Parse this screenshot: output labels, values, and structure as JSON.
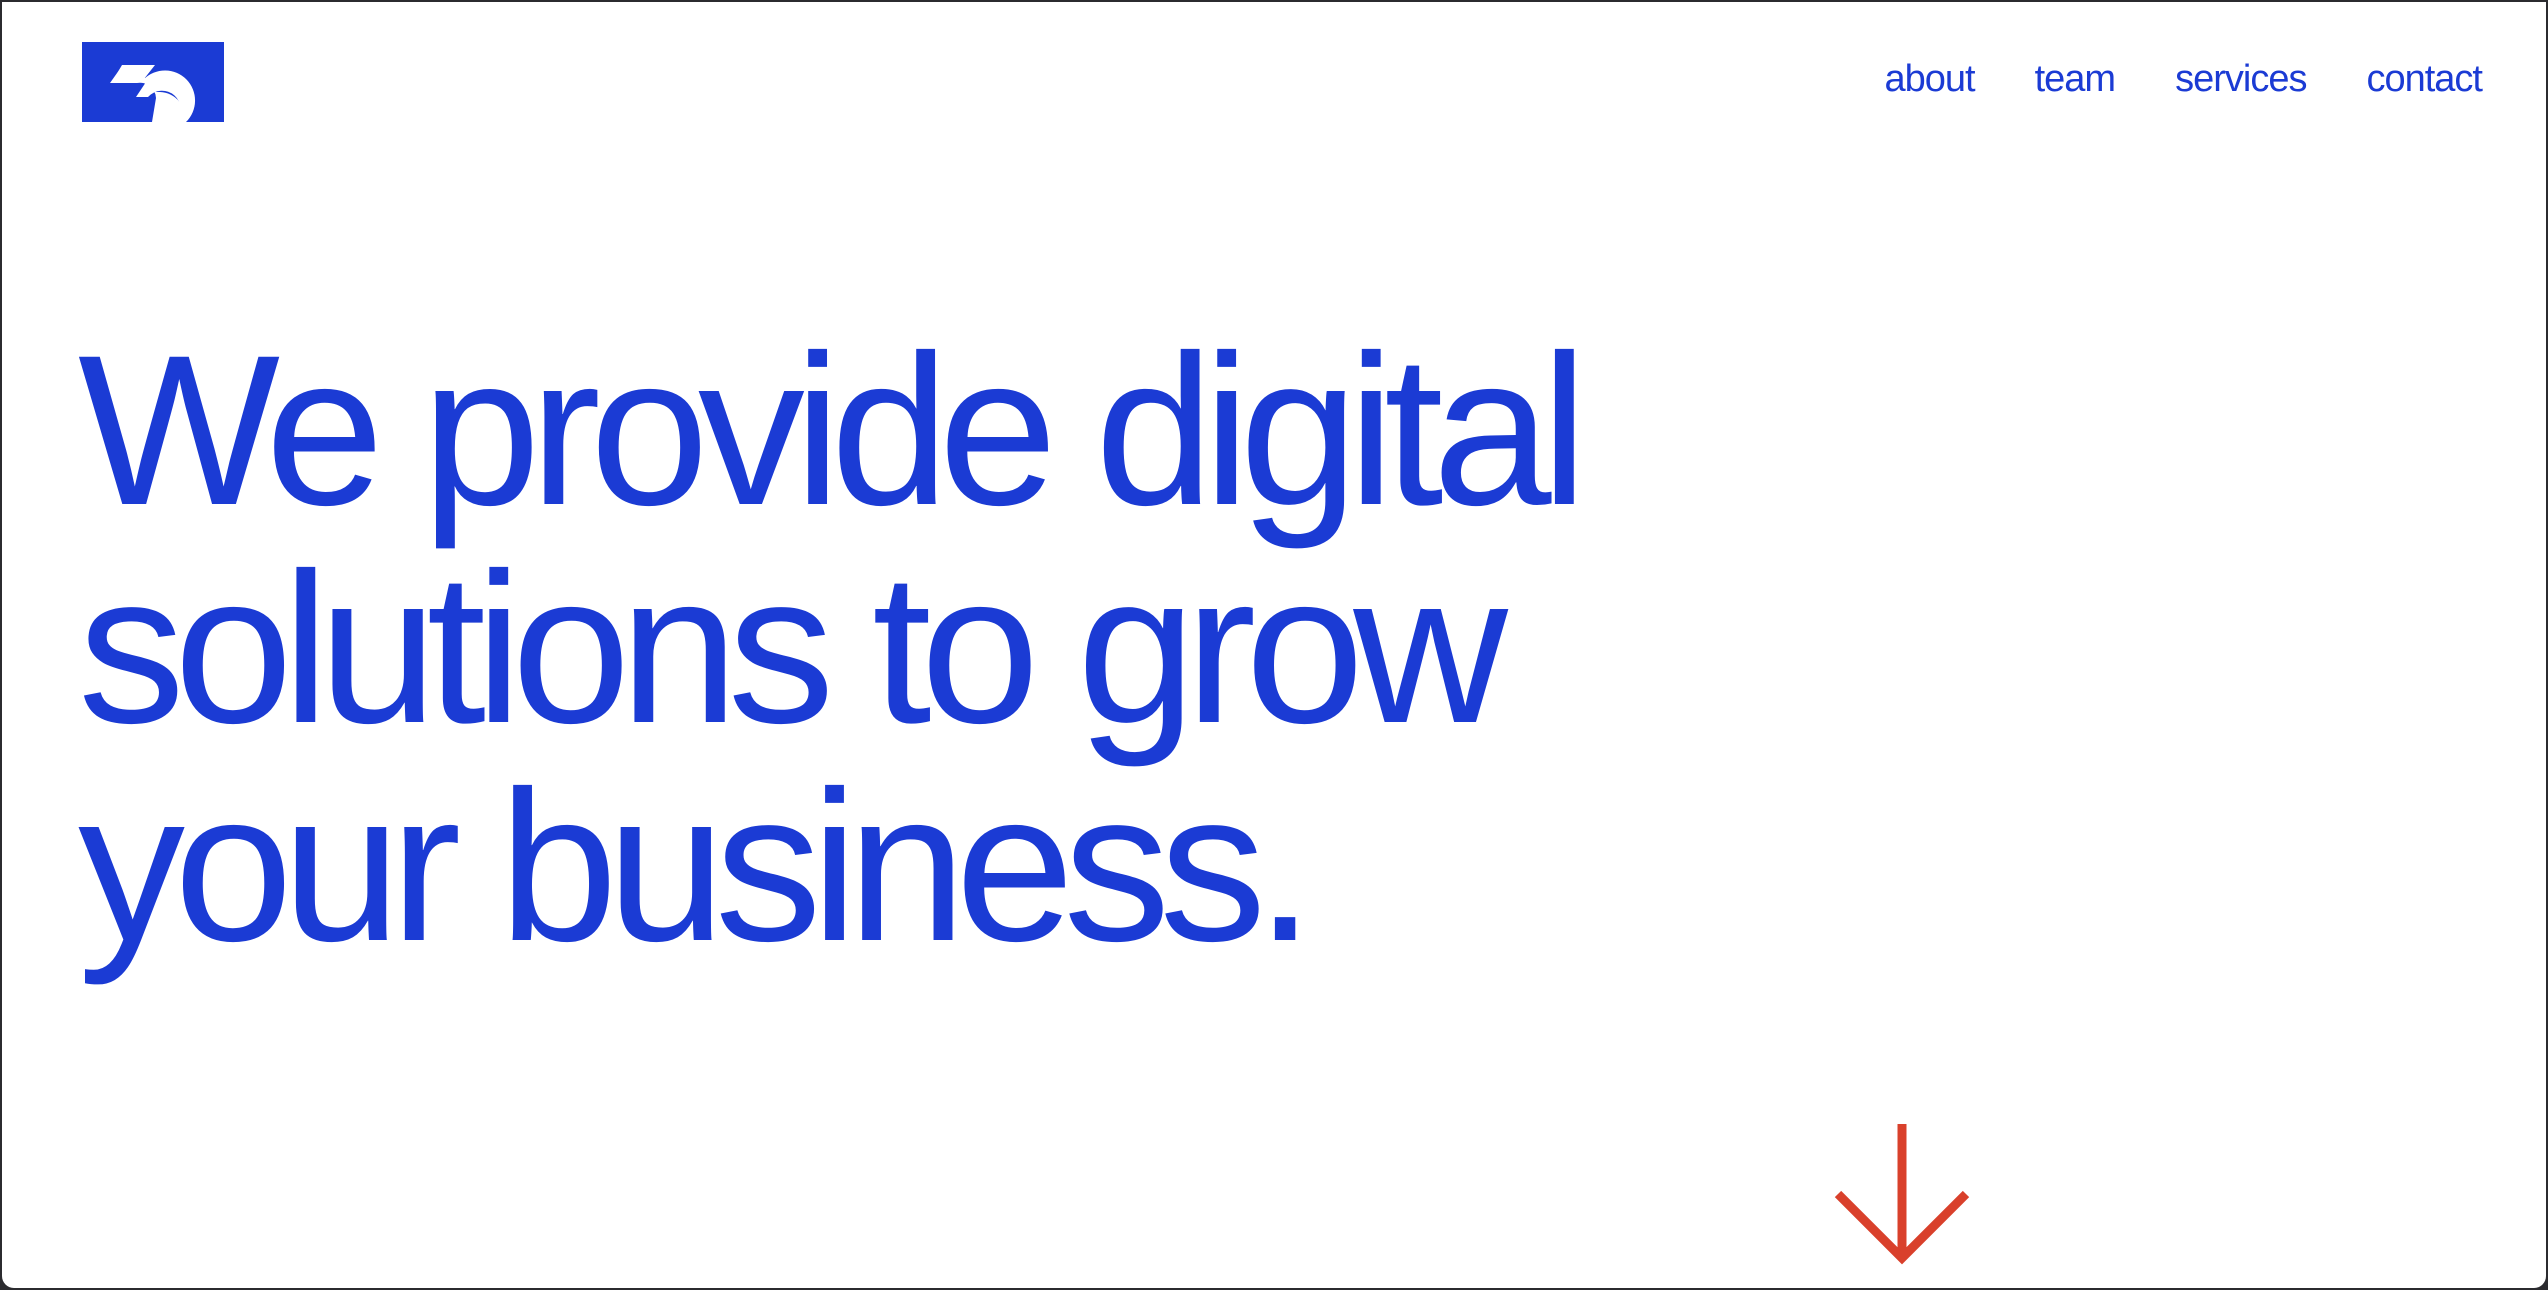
{
  "brand": {
    "accent_color": "#1b3bd4",
    "arrow_color": "#d9402b",
    "logo_icon": "brand-logo-icon"
  },
  "nav": {
    "items": [
      {
        "label": "about"
      },
      {
        "label": "team"
      },
      {
        "label": "services"
      },
      {
        "label": "contact"
      }
    ]
  },
  "hero": {
    "lines": [
      "We provide digital",
      "solutions to grow",
      "your business."
    ]
  },
  "scroll": {
    "icon": "arrow-down-icon"
  }
}
